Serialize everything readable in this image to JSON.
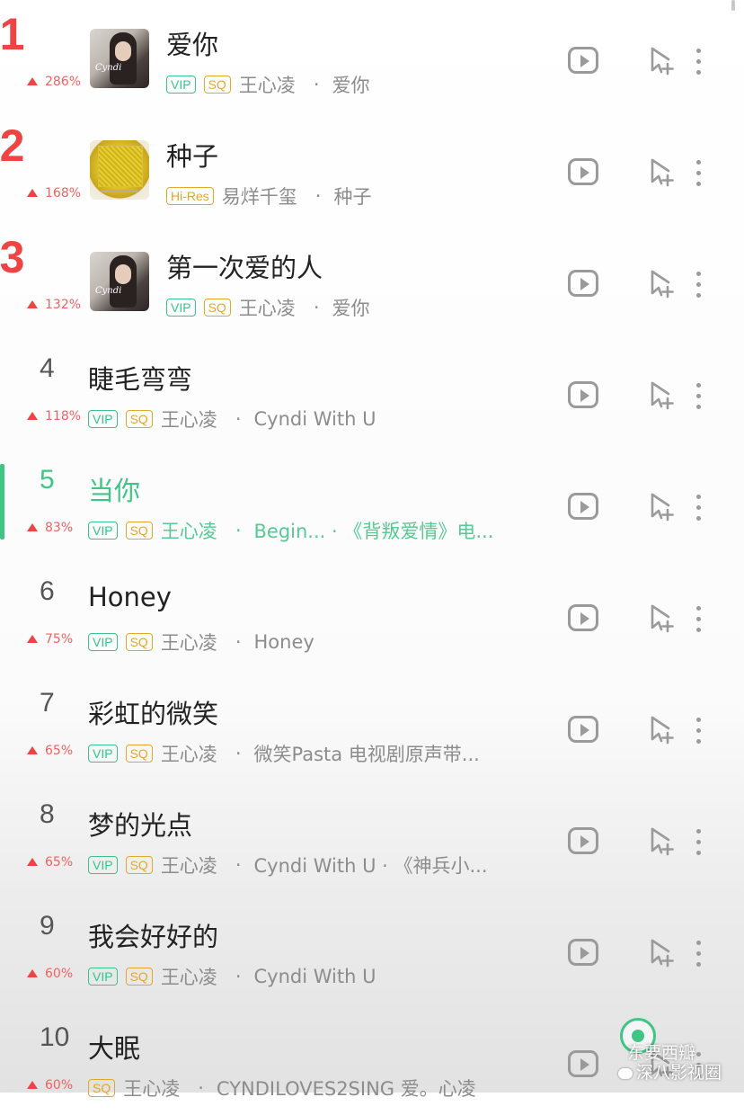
{
  "songs": [
    {
      "rank": "1",
      "trend": "286%",
      "title": "爱你",
      "badges": [
        "VIP",
        "SQ"
      ],
      "artist": "王心凌",
      "album": "爱你",
      "cover": "cyndi"
    },
    {
      "rank": "2",
      "trend": "168%",
      "title": "种子",
      "badges": [
        "Hi-Res"
      ],
      "artist": "易烊千玺",
      "album": "种子",
      "cover": "seed"
    },
    {
      "rank": "3",
      "trend": "132%",
      "title": "第一次爱的人",
      "badges": [
        "VIP",
        "SQ"
      ],
      "artist": "王心凌",
      "album": "爱你",
      "cover": "cyndi"
    },
    {
      "rank": "4",
      "trend": "118%",
      "title": "睫毛弯弯",
      "badges": [
        "VIP",
        "SQ"
      ],
      "artist": "王心凌",
      "album": "Cyndi With U"
    },
    {
      "rank": "5",
      "trend": "83%",
      "title": "当你",
      "badges": [
        "VIP",
        "SQ"
      ],
      "artist": "王心凌",
      "album": "Begin... · 《背叛爱情》电...",
      "playing": true
    },
    {
      "rank": "6",
      "trend": "75%",
      "title": "Honey",
      "badges": [
        "VIP",
        "SQ"
      ],
      "artist": "王心凌",
      "album": "Honey"
    },
    {
      "rank": "7",
      "trend": "65%",
      "title": "彩虹的微笑",
      "badges": [
        "VIP",
        "SQ"
      ],
      "artist": "王心凌",
      "album": "微笑Pasta 电视剧原声带..."
    },
    {
      "rank": "8",
      "trend": "65%",
      "title": "梦的光点",
      "badges": [
        "VIP",
        "SQ"
      ],
      "artist": "王心凌",
      "album": "Cyndi With U · 《神兵小..."
    },
    {
      "rank": "9",
      "trend": "60%",
      "title": "我会好好的",
      "badges": [
        "VIP",
        "SQ"
      ],
      "artist": "王心凌",
      "album": "Cyndi With U"
    },
    {
      "rank": "10",
      "trend": "60%",
      "title": "大眠",
      "badges": [
        "SQ"
      ],
      "artist": "王心凌",
      "album": "CYNDILOVES2SING 爱。心凌"
    }
  ],
  "icons": {
    "play_mv": "play-video-icon",
    "add_to_playlist": "add-to-playlist-icon",
    "more": "more-options-icon"
  },
  "watermark": {
    "line1": "东要西瓣",
    "line2": "深八影视圈"
  },
  "colors": {
    "accent_green": "#41c587",
    "trend_red": "#ee4444",
    "vip_green": "#38c48a",
    "sq_gold": "#e3a72b"
  }
}
